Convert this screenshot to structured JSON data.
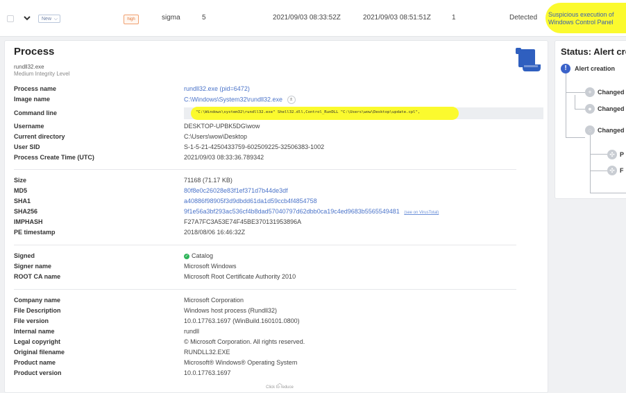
{
  "alert_row": {
    "status": "New",
    "severity": "high",
    "source": "sigma",
    "count": "5",
    "first_seen": "2021/09/03 08:33:52Z",
    "last_seen": "2021/09/03 08:51:51Z",
    "hosts": "1",
    "state": "Detected",
    "rule_line1": "Suspicious execution of",
    "rule_line2": "Windows Control Panel"
  },
  "process": {
    "title": "Process",
    "exe": "rundll32.exe",
    "integrity": "Medium Integrity Level",
    "fields": [
      {
        "label": "Process name",
        "value": "rundll32.exe (pid=6472)"
      },
      {
        "label": "Image name",
        "value": "C:\\Windows\\System32\\rundll32.exe"
      },
      {
        "label": "Command line",
        "value": "\"C:\\Windows\\system32\\rundll32.exe\" Shell32.dll,Control_RunDLL \"C:\\Users\\wow\\Desktop\\update.cpl\","
      },
      {
        "label": "Username",
        "value": "DESKTOP-UPBK5DG\\wow"
      },
      {
        "label": "Current directory",
        "value": "C:\\Users\\wow\\Desktop"
      },
      {
        "label": "User SID",
        "value": "S-1-5-21-4250433759-602509225-32506383-1002"
      },
      {
        "label": "Process Create Time (UTC)",
        "value": "2021/09/03 08:33:36.789342"
      }
    ],
    "file_fields": [
      {
        "label": "Size",
        "value": "71168 (71.17 KB)"
      },
      {
        "label": "MD5",
        "value": "80f8e0c26028e83f1ef371d7b44de3df"
      },
      {
        "label": "SHA1",
        "value": "a40886f98905f3d9dbdd61da1d59ccb4f4854758"
      },
      {
        "label": "SHA256",
        "value": "9f1e56a3bf293ac536cf4b8dad57040797d62dbb0ca19c4ed9683b5565549481"
      },
      {
        "label": "IMPHASH",
        "value": "F27A7FC3A53E74F45BE370131953896A"
      },
      {
        "label": "PE timestamp",
        "value": "2018/08/06 16:46:32Z"
      }
    ],
    "vt_link": "(see on VirusTotal)",
    "sig_fields": [
      {
        "label": "Signed",
        "value": "Catalog"
      },
      {
        "label": "Signer name",
        "value": "Microsoft Windows"
      },
      {
        "label": "ROOT CA name",
        "value": "Microsoft Root Certificate Authority 2010"
      }
    ],
    "ver_fields": [
      {
        "label": "Company name",
        "value": "Microsoft Corporation"
      },
      {
        "label": "File Description",
        "value": "Windows host process (Rundll32)"
      },
      {
        "label": "File version",
        "value": "10.0.17763.1697 (WinBuild.160101.0800)"
      },
      {
        "label": "Internal name",
        "value": "rundll"
      },
      {
        "label": "Legal copyright",
        "value": "© Microsoft Corporation. All rights reserved."
      },
      {
        "label": "Original filename",
        "value": "RUNDLL32.EXE"
      },
      {
        "label": "Product name",
        "value": "Microsoft® Windows® Operating System"
      },
      {
        "label": "Product version",
        "value": "10.0.17763.1697"
      }
    ],
    "reduce_label": "Click to reduce"
  },
  "status_panel": {
    "title": "Status: Alert cre",
    "alert_creation": "Alert creation",
    "changed1": "Changed",
    "changed2": "Changed",
    "changed3": "Changed",
    "p1": "P",
    "p2": "F"
  },
  "colors": {
    "link": "#4a73c9",
    "highlight": "#fbfa2e",
    "severity": "#e0783c",
    "accent": "#3a62c9"
  }
}
